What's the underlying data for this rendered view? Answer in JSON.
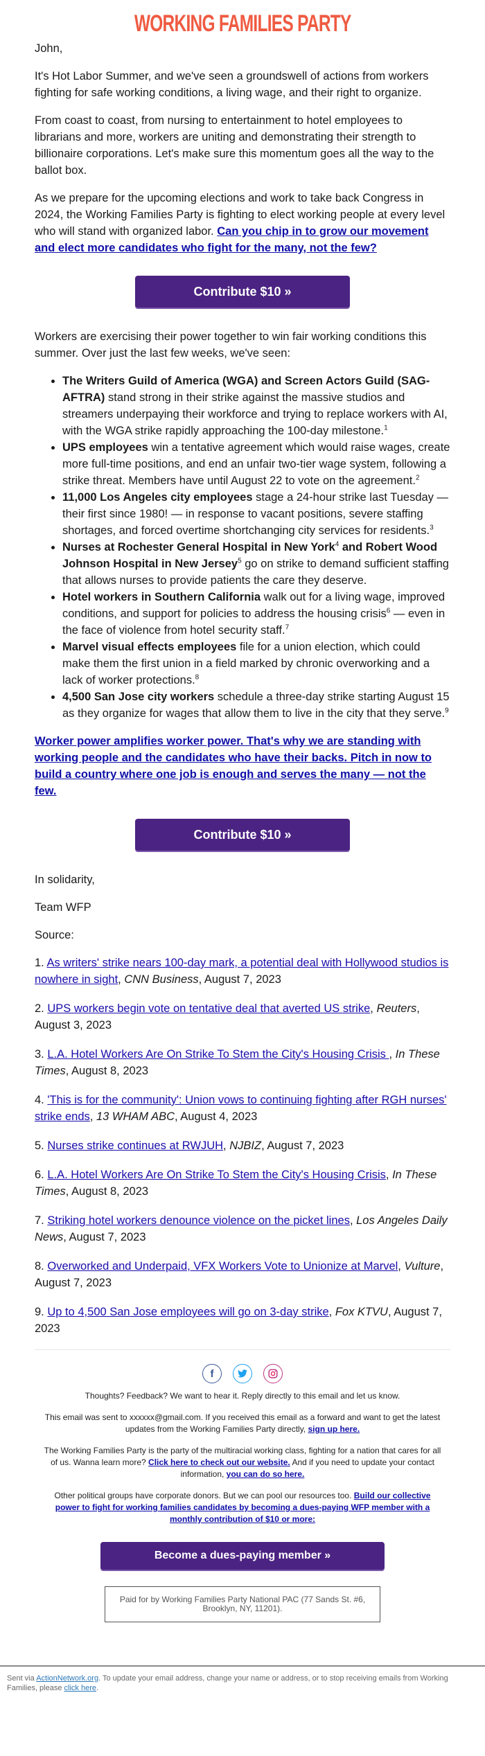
{
  "header": {
    "logo_text": "WORKING FAMILIES PARTY",
    "logo_color": "#ef5b42"
  },
  "greeting": "John,",
  "intro": [
    "It's Hot Labor Summer, and we've seen a groundswell of actions from workers fighting for safe working conditions, a living wage, and their right to organize.",
    "From coast to coast, from nursing to entertainment to hotel employees to librarians and more, workers are uniting and demonstrating their strength to billionaire corporations. Let's make sure this momentum goes all the way to the ballot box."
  ],
  "ask": {
    "text": "As we prepare for the upcoming elections and work to take back Congress in 2024, the Working Families Party is fighting to elect working people at every level who will stand with organized labor. ",
    "link": "Can you chip in to grow our movement and elect more candidates who fight for the many, not the few?"
  },
  "contribute_button": "Contribute $10 »",
  "brand_purple": "#4b2382",
  "workers_intro": "Workers are exercising their power together to win fair working conditions this summer. Over just the last few weeks, we've seen:",
  "bullets": [
    {
      "bold": "The Writers Guild of America (WGA) and Screen Actors Guild (SAG-AFTRA)",
      "text": " stand strong in their strike against the massive studios and streamers underpaying their workforce and trying to replace workers with AI, with the WGA strike rapidly approaching the 100-day milestone.",
      "sup": "1"
    },
    {
      "bold": "UPS employees",
      "text": " win a tentative agreement which would raise wages, create more full-time positions, and end an unfair two-tier wage system, following a strike threat. Members have until August 22 to vote on the agreement.",
      "sup": "2"
    },
    {
      "bold": "11,000 Los Angeles city employees",
      "text": " stage a 24-hour strike last Tuesday — their first since 1980! — in response to vacant positions, severe staffing shortages, and forced overtime shortchanging city services for residents.",
      "sup": "3"
    },
    {
      "bold": "Nurses at Rochester General Hospital in New York",
      "sup_a": "4",
      "bold_b": " and Robert Wood Johnson Hospital in New Jersey",
      "sup_b": "5",
      "text": " go on strike to demand sufficient staffing that allows nurses to provide patients the care they deserve."
    },
    {
      "bold": "Hotel workers in Southern California",
      "text": " walk out for a living wage, improved conditions, and support for policies to address the housing crisis",
      "sup_a": "6",
      "text_b": " — even in the face of violence from hotel security staff.",
      "sup": "7"
    },
    {
      "bold": "Marvel visual effects employees",
      "text": " file for a union election, which could make them the first union in a field marked by chronic overworking and a lack of worker protections.",
      "sup": "8"
    },
    {
      "bold": "4,500 San Jose city workers",
      "text": " schedule a three-day strike starting August 15 as they organize for wages that allow them to live in the city that they serve.",
      "sup": "9"
    }
  ],
  "pitch_link": "Worker power amplifies worker power. That's why we are standing with working people and the candidates who have their backs. Pitch in now to build a country where one job is enough and serves the many — not the few.",
  "signoff": {
    "closing": "In solidarity,",
    "signature": "Team WFP",
    "source_label": "Source:"
  },
  "sources": [
    {
      "num": "1. ",
      "title": "As writers' strike nears 100-day mark, a potential deal with Hollywood studios is nowhere in sight",
      "outlet": "CNN Business",
      "date": ", August 7, 2023"
    },
    {
      "num": "2. ",
      "title": "UPS workers begin vote on tentative deal that averted US strike",
      "outlet": "Reuters",
      "date": ", August 3, 2023"
    },
    {
      "num": "3. ",
      "title": "L.A. Hotel Workers Are On Strike To Stem the City's Housing Crisis ",
      "outlet": "In These Times",
      "date": ", August 8, 2023"
    },
    {
      "num": "4. ",
      "title": "'This is for the community': Union vows to continuing fighting after RGH nurses' strike ends",
      "outlet": "13 WHAM ABC",
      "date": ", August 4, 2023"
    },
    {
      "num": "5. ",
      "title": "Nurses strike continues at RWJUH",
      "outlet": "NJBIZ",
      "date": ", August 7, 2023"
    },
    {
      "num": "6. ",
      "title": "L.A. Hotel Workers Are On Strike To Stem the City's Housing Crisis",
      "outlet": "In These Times",
      "date": ", August 8, 2023"
    },
    {
      "num": "7. ",
      "title": "Striking hotel workers denounce violence on the picket lines",
      "outlet": "Los Angeles Daily News",
      "date": ", August 7, 2023"
    },
    {
      "num": "8. ",
      "title": "Overworked and Underpaid, VFX Workers Vote to Unionize at Marvel",
      "outlet": "Vulture",
      "date": ", August 7, 2023"
    },
    {
      "num": "9. ",
      "title": "Up to 4,500 San Jose employees will go on 3-day strike",
      "outlet": "Fox KTVU",
      "date": ", August 7, 2023"
    }
  ],
  "social": {
    "facebook": "f",
    "twitter": "🐦",
    "instagram": "◎"
  },
  "footer": {
    "feedback": "Thoughts? Feedback? We want to hear it. Reply directly to this email and let us know.",
    "sent_to_text": "This email was sent to xxxxxx@gmail.com. If you received this email as a forward and want to get the latest updates from the Working Families Party directly, ",
    "sign_up_link": "sign up here.",
    "about_text": "The Working Families Party is the party of the multiracial working class, fighting for a nation that cares for all of us. Wanna learn more? ",
    "website_link": "Click here to check out our website.",
    "update_text": " And if you need to update your contact information, ",
    "update_link": "you can do so here.",
    "donors_text": "Other political groups have corporate donors. But we can pool our resources too. ",
    "member_link": "Build our collective power to fight for working families candidates by becoming a dues-paying WFP member with a monthly contribution of $10 or more:",
    "member_button": "Become a dues-paying member »",
    "paid_for": "Paid for by Working Families Party National PAC (77 Sands St. #6, Brooklyn, NY, 11201)."
  },
  "bottom": {
    "sent_via": "Sent via ",
    "action_network_link": "ActionNetwork.org",
    "unsubscribe_text": ". To update your email address, change your name or address, or to stop receiving emails from Working Families, please ",
    "click_here_link": "click here",
    "end": "."
  }
}
